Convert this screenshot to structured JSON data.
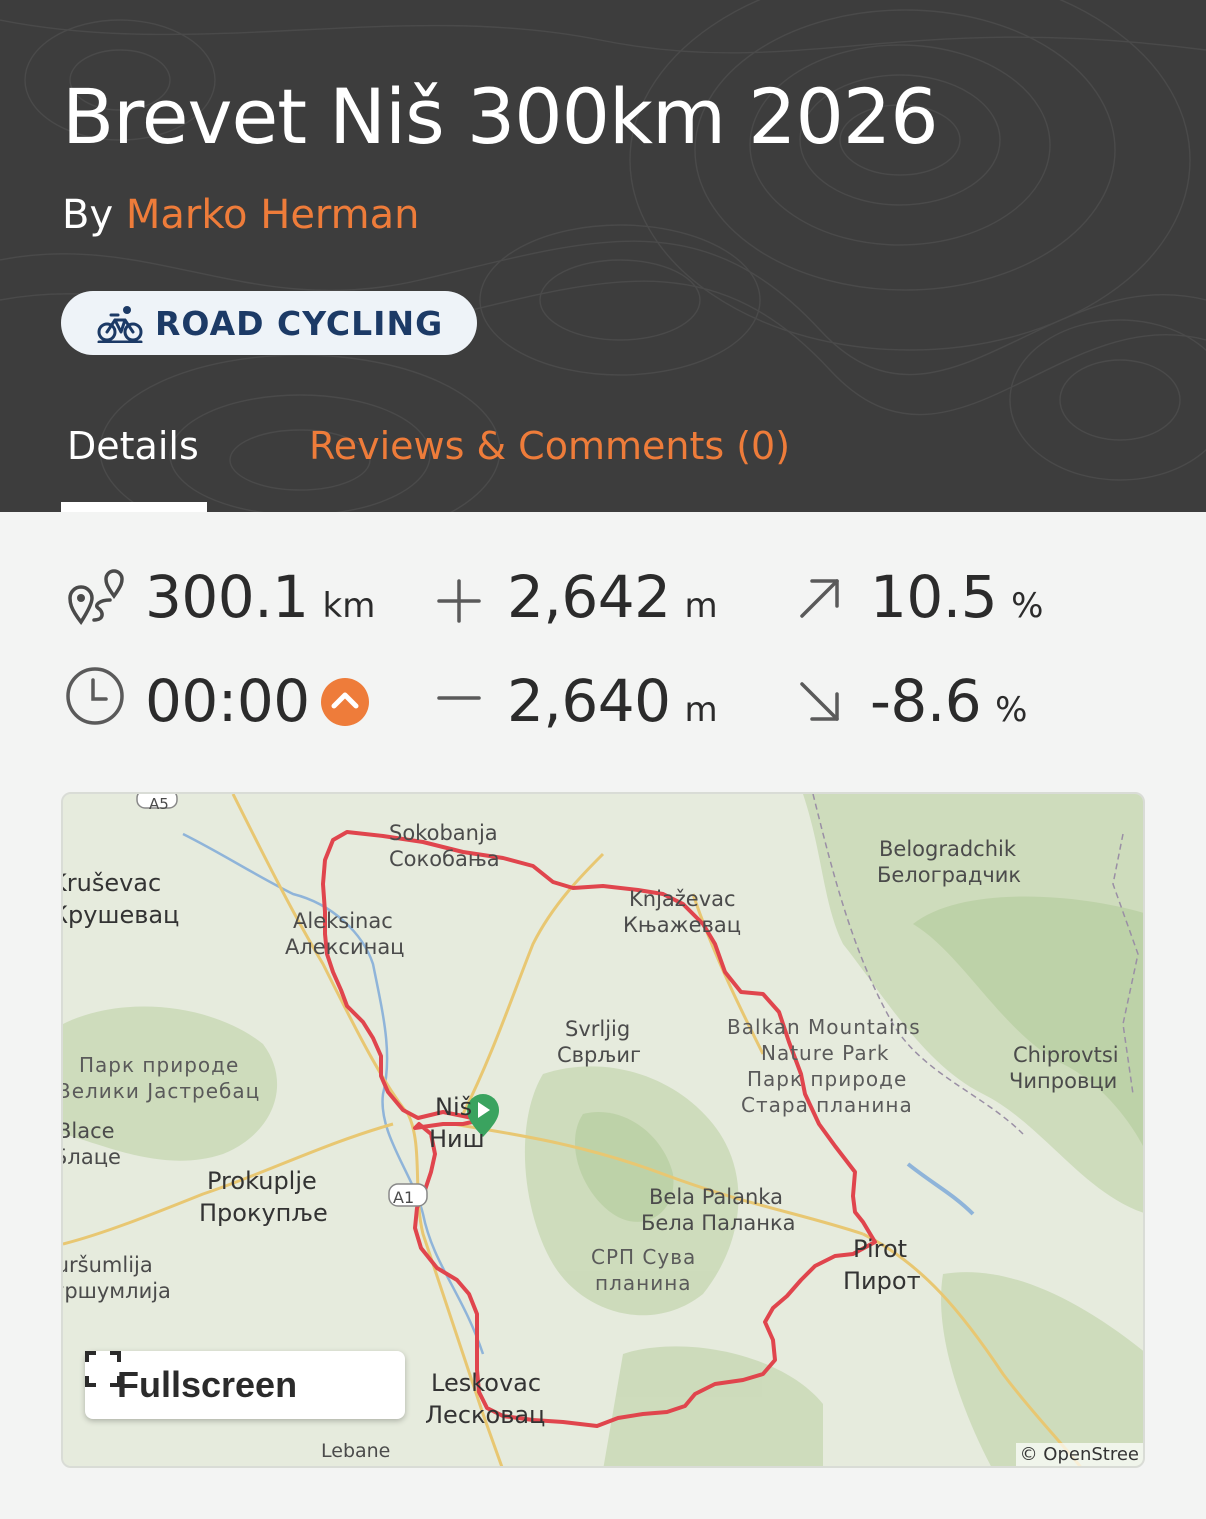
{
  "header": {
    "title": "Brevet Niš 300km 2026",
    "by_prefix": "By",
    "author": "Marko Herman",
    "activity_badge": "ROAD CYCLING"
  },
  "tabs": [
    {
      "label": "Details",
      "active": true
    },
    {
      "label": "Reviews & Comments (0)",
      "active": false
    }
  ],
  "stats": {
    "distance": {
      "value": "300.1",
      "unit": "km",
      "icon": "route-distance-icon"
    },
    "elevation_gain": {
      "value": "2,642",
      "unit": "m",
      "icon": "plus-icon"
    },
    "max_grade": {
      "value": "10.5",
      "unit": "%",
      "icon": "arrow-up-right-icon"
    },
    "duration": {
      "value": "00:00",
      "icon": "clock-icon",
      "toggle_icon": "chevron-up-icon"
    },
    "elevation_loss": {
      "value": "2,640",
      "unit": "m",
      "icon": "minus-icon"
    },
    "min_grade": {
      "value": "-8.6",
      "unit": "%",
      "icon": "arrow-down-right-icon"
    }
  },
  "map": {
    "labels": {
      "sokobanja_lat": "Sokobanja",
      "sokobanja_cyr": "Сокобања",
      "krusevac_lat": "Kruševac",
      "krusevac_cyr": "Крушевац",
      "aleksinac_lat": "Aleksinac",
      "aleksinac_cyr": "Алексинац",
      "knjazevac_lat": "Knjaževac",
      "knjazevac_cyr": "Књажевац",
      "belogradchik_lat": "Belogradchik",
      "belogradchik_cyr": "Белоградчик",
      "svrljig_lat": "Svrljig",
      "svrljig_cyr": "Сврљиг",
      "balkan_1": "Balkan Mountains",
      "balkan_2": "Nature Park",
      "balkan_3": "Парк природе",
      "balkan_4": "Стара планина",
      "chiprovtsi_lat": "Chiprovtsi",
      "chiprovtsi_cyr": "Чипровци",
      "jastrebac_1": "Парк природе",
      "jastrebac_2": "Велики Јастребац",
      "nis_lat": "Niš",
      "nis_cyr": "Ниш",
      "blace_lat": "Blace",
      "blace_cyr": "Блаце",
      "prokuplje_lat": "Prokuplje",
      "prokuplje_cyr": "Прокупље",
      "bela_lat": "Bela Palanka",
      "bela_cyr": "Бела Паланка",
      "suva_1": "СРП Сува",
      "suva_2": "планина",
      "pirot_lat": "Pirot",
      "pirot_cyr": "Пирот",
      "kursumlija_lat": "Kuršumlija",
      "kursumlija_cyr": "Куршумлија",
      "leskovac_lat": "Leskovac",
      "leskovac_cyr": "Лесковац",
      "lebane": "Lebane",
      "a5": "A5",
      "a1": "A1"
    },
    "fullscreen_label": "Fullscreen",
    "attribution": "© OpenStree"
  },
  "colors": {
    "accent": "#ee7c3a",
    "header_bg": "#3d3d3d",
    "route": "#e0454d",
    "start_marker": "#3aa35f"
  }
}
